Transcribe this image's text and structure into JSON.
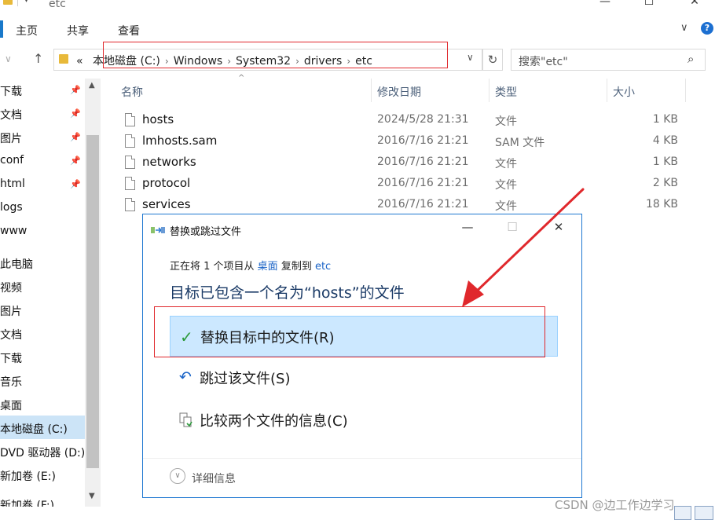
{
  "window": {
    "title": "etc",
    "controls": {
      "minimize": "—",
      "maximize": "☐",
      "close": "✕"
    }
  },
  "ribbon": {
    "tabs": [
      "主页",
      "共享",
      "查看"
    ],
    "expand": "∨",
    "help": "?"
  },
  "address": {
    "overflow": "«",
    "crumbs": [
      "本地磁盘 (C:)",
      "Windows",
      "System32",
      "drivers",
      "etc"
    ],
    "search_placeholder": "搜索\"etc\""
  },
  "sidebar": {
    "items": [
      {
        "label": "下载",
        "pinned": true
      },
      {
        "label": "文档",
        "pinned": true
      },
      {
        "label": "图片",
        "pinned": true
      },
      {
        "label": "conf",
        "pinned": true
      },
      {
        "label": "html",
        "pinned": true
      },
      {
        "label": "logs",
        "pinned": false
      },
      {
        "label": "www",
        "pinned": false
      },
      {
        "label": "此电脑",
        "pinned": false
      },
      {
        "label": "视频",
        "pinned": false
      },
      {
        "label": "图片",
        "pinned": false
      },
      {
        "label": "文档",
        "pinned": false
      },
      {
        "label": "下载",
        "pinned": false
      },
      {
        "label": "音乐",
        "pinned": false
      },
      {
        "label": "桌面",
        "pinned": false
      },
      {
        "label": "本地磁盘 (C:)",
        "pinned": false,
        "selected": true
      },
      {
        "label": "DVD 驱动器 (D:)",
        "pinned": false
      },
      {
        "label": "新加卷 (E:)",
        "pinned": false
      },
      {
        "label": "新加卷 (F:)",
        "pinned": false
      }
    ]
  },
  "filelist": {
    "columns": {
      "name": "名称",
      "date": "修改日期",
      "type": "类型",
      "size": "大小"
    },
    "rows": [
      {
        "name": "hosts",
        "date": "2024/5/28 21:31",
        "type": "文件",
        "size": "1 KB"
      },
      {
        "name": "lmhosts.sam",
        "date": "2016/7/16 21:21",
        "type": "SAM 文件",
        "size": "4 KB"
      },
      {
        "name": "networks",
        "date": "2016/7/16 21:21",
        "type": "文件",
        "size": "1 KB"
      },
      {
        "name": "protocol",
        "date": "2016/7/16 21:21",
        "type": "文件",
        "size": "2 KB"
      },
      {
        "name": "services",
        "date": "2016/7/16 21:21",
        "type": "文件",
        "size": "18 KB"
      }
    ]
  },
  "dialog": {
    "title": "替换或跳过文件",
    "info_prefix": "正在将 1 个项目从 ",
    "info_source": "桌面",
    "info_middle": " 复制到 ",
    "info_dest": "etc",
    "heading": "目标已包含一个名为“hosts”的文件",
    "options": {
      "replace": "替换目标中的文件(R)",
      "skip": "跳过该文件(S)",
      "compare": "比较两个文件的信息(C)"
    },
    "more_details": "详细信息"
  },
  "watermark": "CSDN @边工作边学习",
  "colors": {
    "accent": "#1f78d1",
    "highlight": "#e0282c",
    "selection": "#cce8ff"
  }
}
